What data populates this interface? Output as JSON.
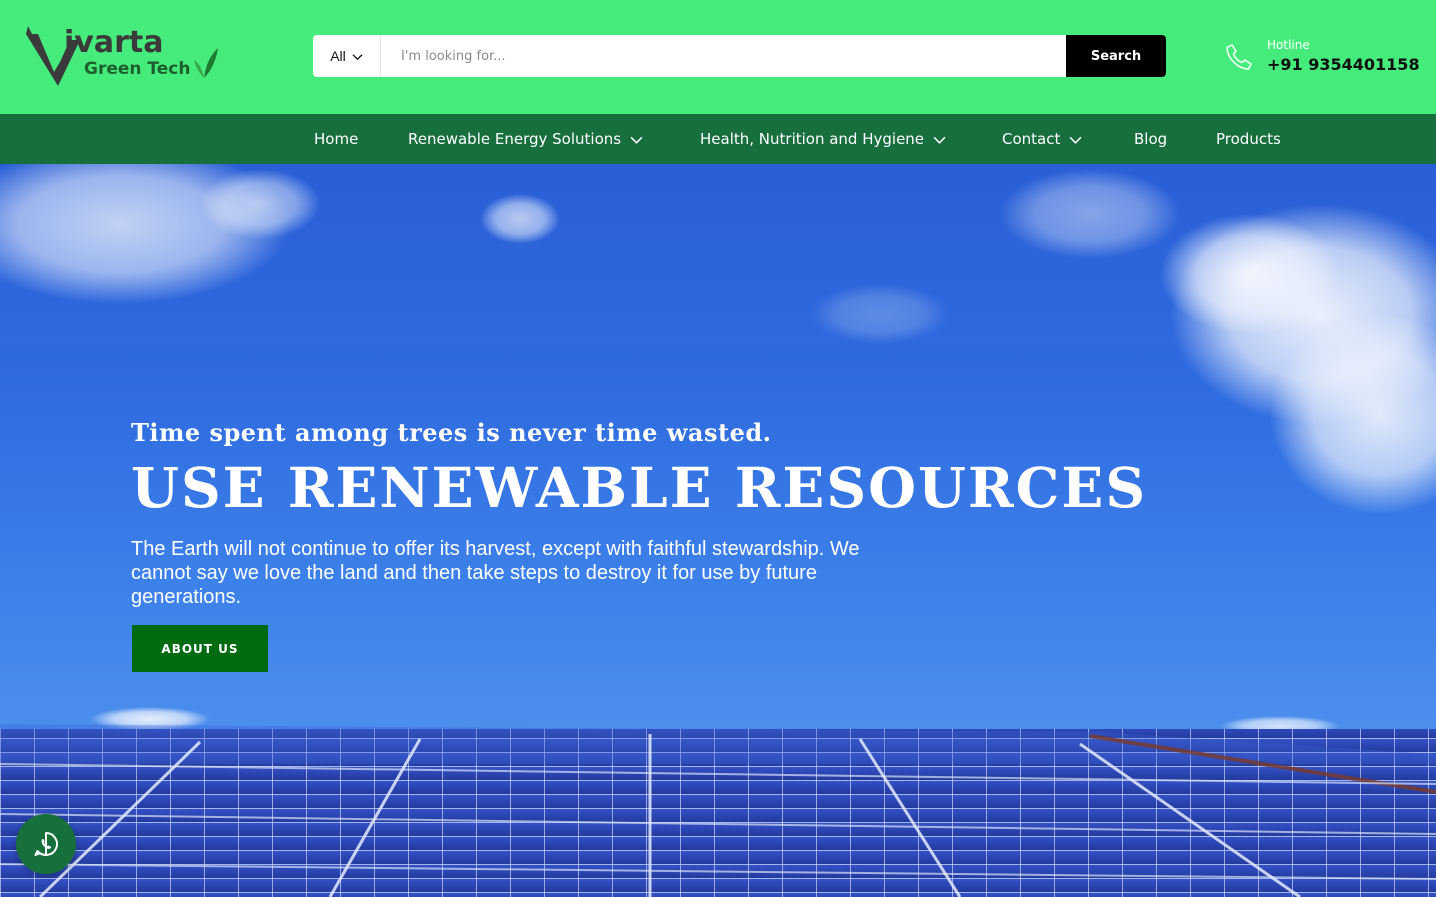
{
  "header": {
    "logo": {
      "title": "ivarta",
      "subtitle": "Green Tech"
    },
    "search": {
      "category": "All",
      "placeholder": "I'm looking for...",
      "button_label": "Search"
    },
    "hotline": {
      "label": "Hotline",
      "number": "+91 9354401158",
      "icon": "phone-icon"
    }
  },
  "nav": {
    "items": [
      {
        "label": "Home",
        "has_dropdown": false
      },
      {
        "label": "Renewable Energy Solutions",
        "has_dropdown": true
      },
      {
        "label": "Health, Nutrition and Hygiene",
        "has_dropdown": true
      },
      {
        "label": "Contact",
        "has_dropdown": true
      },
      {
        "label": "Blog",
        "has_dropdown": false
      },
      {
        "label": "Products",
        "has_dropdown": false
      }
    ]
  },
  "hero": {
    "subtitle": "Time spent among trees is never time wasted.",
    "title": "USE RENEWABLE RESOURCES",
    "description": "The Earth will not continue to offer its harvest, except with faithful stewardship. We cannot say we love the land and then take steps to destroy it for use by future generations.",
    "button_label": "ABOUT US"
  },
  "floating": {
    "icon": "whatsapp-icon"
  },
  "colors": {
    "topbar": "#45ec7b",
    "navbar": "#166f3d",
    "button_green": "#006b10",
    "search_button": "#000000"
  }
}
